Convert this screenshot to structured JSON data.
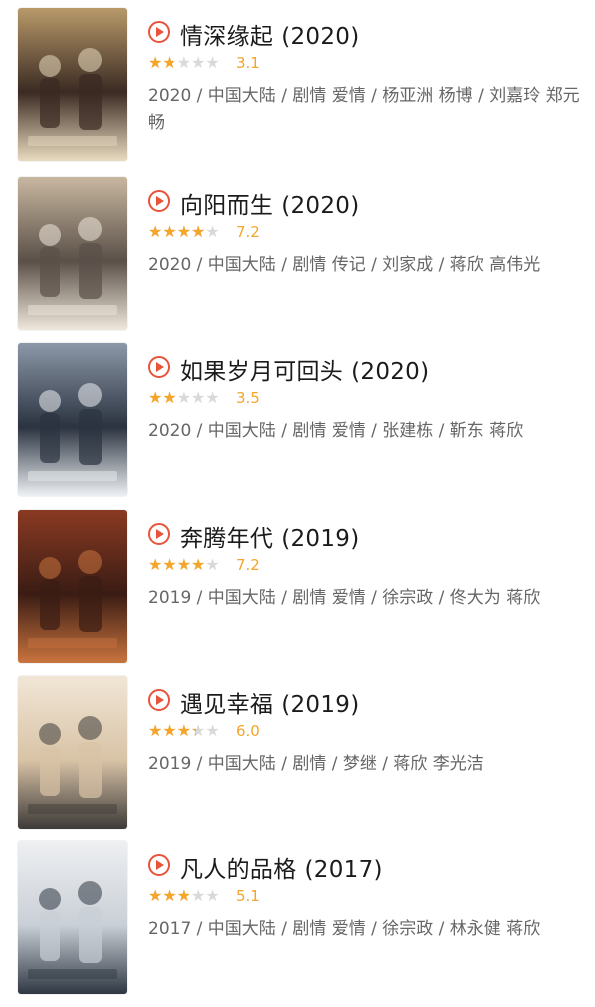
{
  "colors": {
    "accent": "#e8543b",
    "star": "#f4a52a",
    "star_empty": "#d9d9d9",
    "meta_text": "#666666"
  },
  "icons": {
    "play": "play-circle-icon",
    "star": "star-icon"
  },
  "shows": [
    {
      "title": "情深缘起",
      "year": "(2020)",
      "rating_fraction": 0.31,
      "score": "3.1",
      "meta": "2020 / 中国大陆 / 剧情 爱情 / 杨亚洲 杨博 / 刘嘉玲 郑元畅",
      "poster_colors": [
        "#3a2a22",
        "#b89a6a",
        "#e9dcc0"
      ]
    },
    {
      "title": "向阳而生",
      "year": "(2020)",
      "rating_fraction": 0.72,
      "score": "7.2",
      "meta": "2020 / 中国大陆 / 剧情 传记 / 刘家成 / 蒋欣 高伟光",
      "poster_colors": [
        "#5a5048",
        "#c8b7a0",
        "#f0e8dc"
      ]
    },
    {
      "title": "如果岁月可回头",
      "year": "(2020)",
      "rating_fraction": 0.35,
      "score": "3.5",
      "meta": "2020 / 中国大陆 / 剧情 爱情 / 张建栋 / 靳东 蒋欣",
      "poster_colors": [
        "#2b3340",
        "#8c98a8",
        "#eef1f4"
      ]
    },
    {
      "title": "奔腾年代",
      "year": "(2019)",
      "rating_fraction": 0.72,
      "score": "7.2",
      "meta": "2019 / 中国大陆 / 剧情 爱情 / 徐宗政 / 佟大为 蒋欣",
      "poster_colors": [
        "#3a1c14",
        "#8a3a22",
        "#c9743e"
      ]
    },
    {
      "title": "遇见幸福",
      "year": "(2019)",
      "rating_fraction": 0.6,
      "score": "6.0",
      "meta": "2019 / 中国大陆 / 剧情 / 梦继 / 蒋欣 李光洁",
      "poster_colors": [
        "#d8c3a6",
        "#f1e6d6",
        "#3d3a38"
      ]
    },
    {
      "title": "凡人的品格",
      "year": "(2017)",
      "rating_fraction": 0.51,
      "score": "5.1",
      "meta": "2017 / 中国大陆 / 剧情 爱情 / 徐宗政 / 林永健 蒋欣",
      "poster_colors": [
        "#c9cfd6",
        "#eef0f2",
        "#2f3742"
      ]
    }
  ]
}
